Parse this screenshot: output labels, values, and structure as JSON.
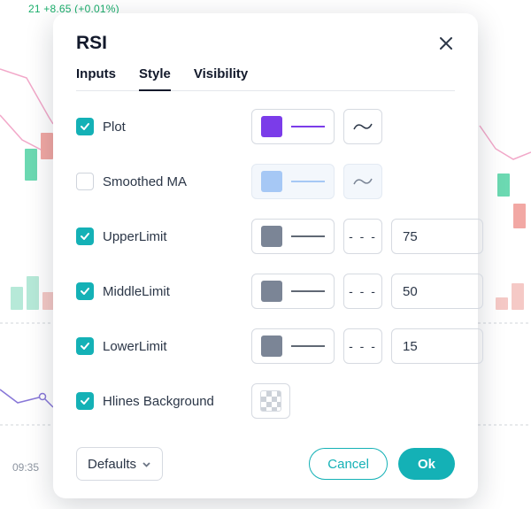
{
  "bg": {
    "top_text": "21 +8.65 (+0.01%)",
    "time_label": "09:35"
  },
  "dialog": {
    "title": "RSI",
    "tabs": {
      "inputs": "Inputs",
      "style": "Style",
      "visibility": "Visibility"
    },
    "rows": {
      "plot": {
        "label": "Plot",
        "checked": true,
        "color": "#7b3ce9"
      },
      "smoothed": {
        "label": "Smoothed MA",
        "checked": false,
        "color": "#a6c8f5"
      },
      "upper": {
        "label": "UpperLimit",
        "checked": true,
        "color": "#7b8596",
        "value": "75"
      },
      "middle": {
        "label": "MiddleLimit",
        "checked": true,
        "color": "#7b8596",
        "value": "50"
      },
      "lower": {
        "label": "LowerLimit",
        "checked": true,
        "color": "#7b8596",
        "value": "15"
      },
      "hlines": {
        "label": "Hlines Background",
        "checked": true
      }
    },
    "dash_display": "- - -",
    "footer": {
      "defaults": "Defaults",
      "cancel": "Cancel",
      "ok": "Ok"
    }
  }
}
